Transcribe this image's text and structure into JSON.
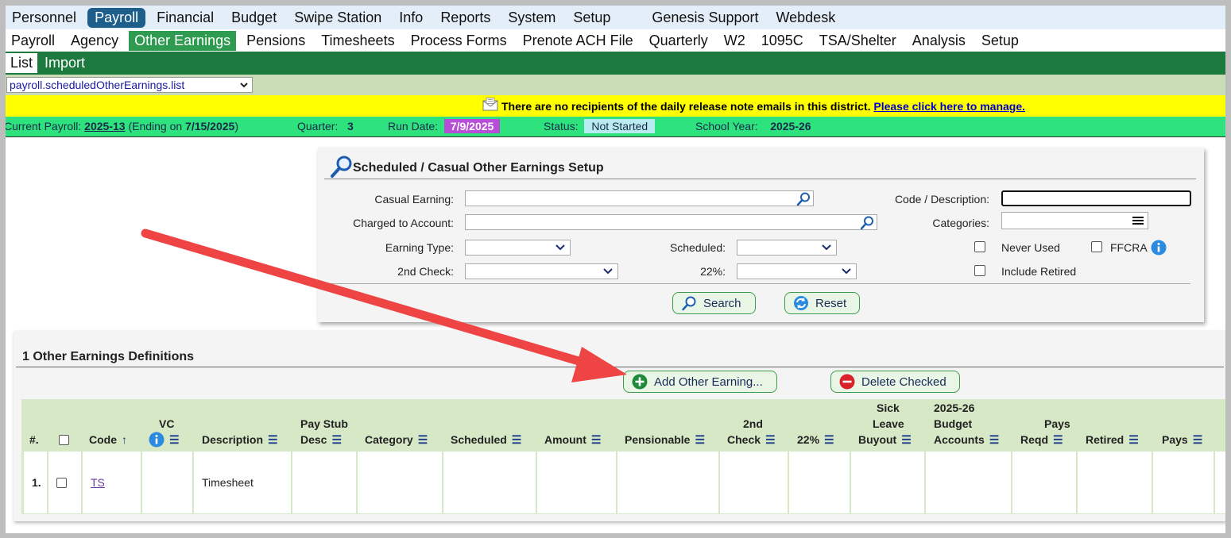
{
  "top_menu": [
    "Personnel",
    "Payroll",
    "Financial",
    "Budget",
    "Swipe Station",
    "Info",
    "Reports",
    "System",
    "Setup",
    "Genesis Support",
    "Webdesk"
  ],
  "top_menu_active": "Payroll",
  "sub_menu": [
    "Payroll",
    "Agency",
    "Other Earnings",
    "Pensions",
    "Timesheets",
    "Process Forms",
    "Prenote ACH File",
    "Quarterly",
    "W2",
    "1095C",
    "TSA/Shelter",
    "Analysis",
    "Setup"
  ],
  "sub_menu_active": "Other Earnings",
  "tabs": [
    "List",
    "Import"
  ],
  "tabs_active": "List",
  "path_select": "payroll.scheduledOtherEarnings.list",
  "notice": {
    "text": "There are no recipients of the daily release note emails in this district.",
    "link": "Please click here to manage."
  },
  "status": {
    "current_payroll_label": "Current Payroll:",
    "current_payroll_value": "2025-13",
    "ending_prefix": "(Ending on",
    "ending_date": "7/15/2025",
    "ending_suffix": ")",
    "quarter_label": "Quarter:",
    "quarter_value": "3",
    "run_date_label": "Run Date:",
    "run_date_value": "7/9/2025",
    "status_label": "Status:",
    "status_value": "Not Started",
    "school_year_label": "School Year:",
    "school_year_value": "2025-26"
  },
  "setup": {
    "title": "Scheduled / Casual Other Earnings Setup",
    "casual_earning_label": "Casual Earning:",
    "charged_to_account_label": "Charged to Account:",
    "earning_type_label": "Earning Type:",
    "second_check_label": "2nd Check:",
    "scheduled_label": "Scheduled:",
    "pct22_label": "22%:",
    "code_description_label": "Code / Description:",
    "categories_label": "Categories:",
    "never_used_label": "Never Used",
    "ffcra_label": "FFCRA",
    "include_retired_label": "Include Retired",
    "search_button": "Search",
    "reset_button": "Reset"
  },
  "list": {
    "title": "1 Other Earnings Definitions",
    "add_button": "Add Other Earning...",
    "delete_button": "Delete Checked",
    "headers": {
      "num": "#.",
      "code": "Code",
      "vc": "VC",
      "description": "Description",
      "pay_stub_desc_1": "Pay Stub",
      "pay_stub_desc_2": "Desc",
      "category": "Category",
      "scheduled": "Scheduled",
      "amount": "Amount",
      "pensionable": "Pensionable",
      "second_check_1": "2nd",
      "second_check_2": "Check",
      "pct22": "22%",
      "sick_1": "Sick",
      "sick_2": "Leave",
      "sick_3": "Buyout",
      "budget_1": "2025-26",
      "budget_2": "Budget",
      "budget_3": "Accounts",
      "pays_reqd_1": "Pays",
      "pays_reqd_2": "Reqd",
      "retired": "Retired",
      "pays": "Pays"
    },
    "rows": [
      {
        "num": "1.",
        "code": "TS",
        "description": "Timesheet"
      }
    ]
  },
  "colors": {
    "active_top": "#1d5f8a",
    "active_sub": "#2e9b50",
    "tab_bar": "#1d7a3e",
    "status_bar": "#2ee37d",
    "notice": "#ffff00",
    "arrow": "#ef4444"
  }
}
